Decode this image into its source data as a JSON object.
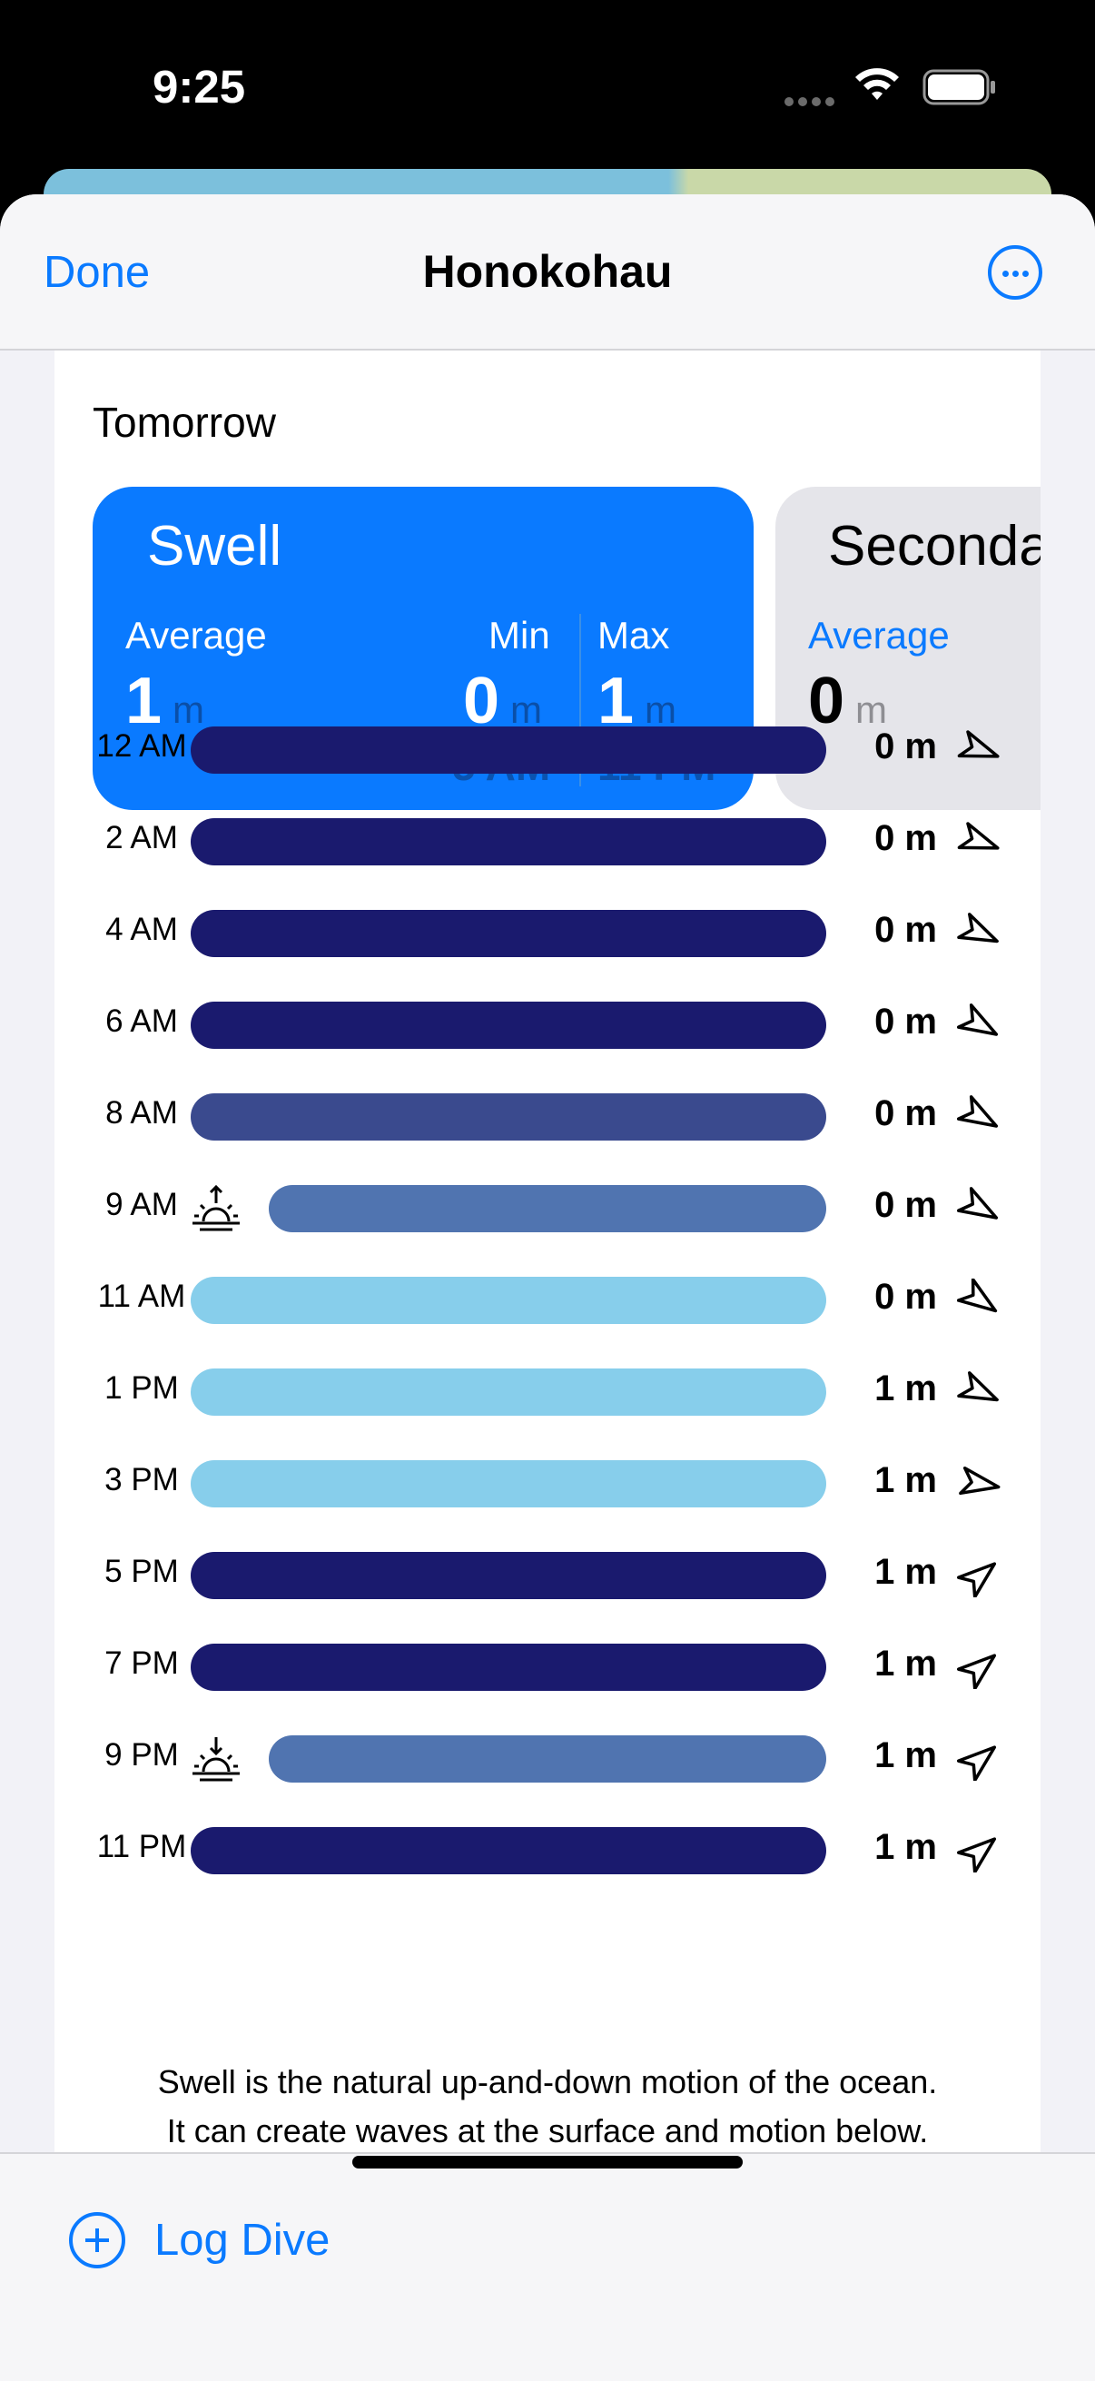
{
  "status_bar": {
    "time": "9:25"
  },
  "nav": {
    "done_label": "Done",
    "title": "Honokohau",
    "more_icon": "ellipsis-circle-icon"
  },
  "day_label": "Tomorrow",
  "colors": {
    "accent": "#0a7aff",
    "low": "#1a1a6e",
    "mid_dark": "#3a4a8e",
    "mid": "#5074b0",
    "light": "#87ceeb"
  },
  "metrics": [
    {
      "title": "Swell",
      "average_label": "Average",
      "average_value": "1",
      "average_unit": "m",
      "min_label": "Min",
      "min_value": "0",
      "min_unit": "m",
      "min_time": "5 AM",
      "max_label": "Max",
      "max_value": "1",
      "max_unit": "m",
      "max_time": "11 PM"
    },
    {
      "title": "Seconda",
      "average_label": "Average",
      "average_value": "0",
      "average_unit": "m"
    }
  ],
  "rows": [
    {
      "time": "12 AM",
      "value": "0 m",
      "color": "#1a1a6e",
      "direction_deg": 20,
      "icon": ""
    },
    {
      "time": "2 AM",
      "value": "0 m",
      "color": "#1a1a6e",
      "direction_deg": 20,
      "icon": ""
    },
    {
      "time": "4 AM",
      "value": "0 m",
      "color": "#1a1a6e",
      "direction_deg": 25,
      "icon": ""
    },
    {
      "time": "6 AM",
      "value": "0 m",
      "color": "#1a1a6e",
      "direction_deg": 30,
      "icon": ""
    },
    {
      "time": "8 AM",
      "value": "0 m",
      "color": "#3a4a8e",
      "direction_deg": 30,
      "icon": ""
    },
    {
      "time": "9 AM",
      "value": "0 m",
      "color": "#5074b0",
      "direction_deg": 30,
      "icon": "sunrise-icon"
    },
    {
      "time": "11 AM",
      "value": "0 m",
      "color": "#87ceeb",
      "direction_deg": 35,
      "icon": ""
    },
    {
      "time": "1 PM",
      "value": "1 m",
      "color": "#87ceeb",
      "direction_deg": 25,
      "icon": ""
    },
    {
      "time": "3 PM",
      "value": "1 m",
      "color": "#87ceeb",
      "direction_deg": 10,
      "icon": ""
    },
    {
      "time": "5 PM",
      "value": "1 m",
      "color": "#1a1a6e",
      "direction_deg": -40,
      "icon": ""
    },
    {
      "time": "7 PM",
      "value": "1 m",
      "color": "#1a1a6e",
      "direction_deg": -40,
      "icon": ""
    },
    {
      "time": "9 PM",
      "value": "1 m",
      "color": "#5074b0",
      "direction_deg": -40,
      "icon": "sunset-icon"
    },
    {
      "time": "11 PM",
      "value": "1 m",
      "color": "#1a1a6e",
      "direction_deg": -40,
      "icon": ""
    }
  ],
  "footnote": {
    "line1": "Swell is the natural up-and-down motion of the ocean.",
    "line2": "It can create waves at the surface and motion below."
  },
  "toolbar": {
    "log_dive_label": "Log Dive"
  }
}
